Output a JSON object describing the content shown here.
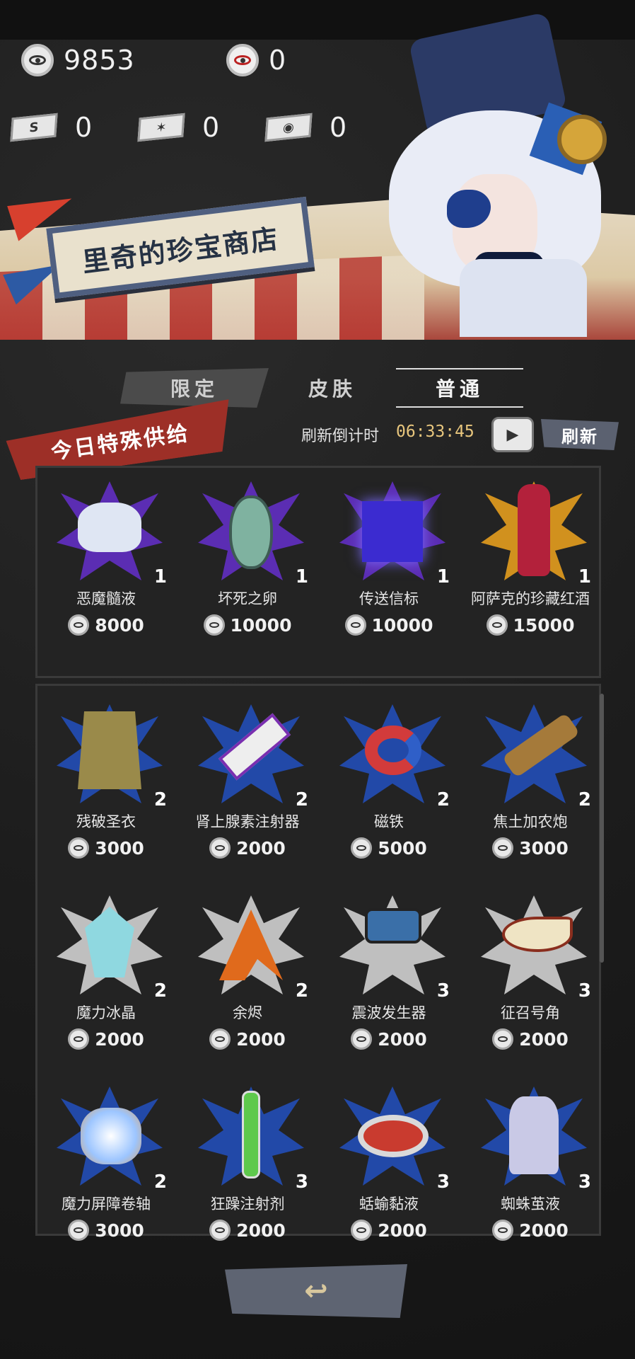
{
  "currencies": {
    "coins": "9853",
    "eyes": "0",
    "ticket1": "0",
    "ticket2": "0",
    "ticket3": "0"
  },
  "shop": {
    "title": "里奇的珍宝商店"
  },
  "tabs": [
    {
      "label": "限定"
    },
    {
      "label": "皮肤"
    },
    {
      "label": "普通"
    }
  ],
  "special": {
    "header": "今日特殊供给",
    "countdown_label": "刷新倒计时",
    "countdown": "06:33:45",
    "refresh_label": "刷新",
    "items": [
      {
        "name": "恶魔髓液",
        "qty": "1",
        "price": "8000"
      },
      {
        "name": "坏死之卵",
        "qty": "1",
        "price": "10000"
      },
      {
        "name": "传送信标",
        "qty": "1",
        "price": "10000"
      },
      {
        "name": "阿萨克的珍藏红酒",
        "qty": "1",
        "price": "15000"
      }
    ]
  },
  "normal_items": [
    {
      "name": "残破圣衣",
      "qty": "2",
      "price": "3000"
    },
    {
      "name": "肾上腺素注射器",
      "qty": "2",
      "price": "2000"
    },
    {
      "name": "磁铁",
      "qty": "2",
      "price": "5000"
    },
    {
      "name": "焦土加农炮",
      "qty": "2",
      "price": "3000"
    },
    {
      "name": "魔力冰晶",
      "qty": "2",
      "price": "2000"
    },
    {
      "name": "余烬",
      "qty": "2",
      "price": "2000"
    },
    {
      "name": "震波发生器",
      "qty": "3",
      "price": "2000"
    },
    {
      "name": "征召号角",
      "qty": "3",
      "price": "2000"
    },
    {
      "name": "魔力屏障卷轴",
      "qty": "2",
      "price": "3000"
    },
    {
      "name": "狂躁注射剂",
      "qty": "3",
      "price": "2000"
    },
    {
      "name": "蛞蝓黏液",
      "qty": "3",
      "price": "2000"
    },
    {
      "name": "蜘蛛茧液",
      "qty": "3",
      "price": "2000"
    }
  ],
  "colors": {
    "accent_red": "#9d2f27",
    "countdown": "#e8c67d",
    "burst_purple": "#5b2db3",
    "burst_gold": "#d1911e",
    "burst_blue": "#2249a8",
    "burst_gray": "#bfbfbf"
  }
}
